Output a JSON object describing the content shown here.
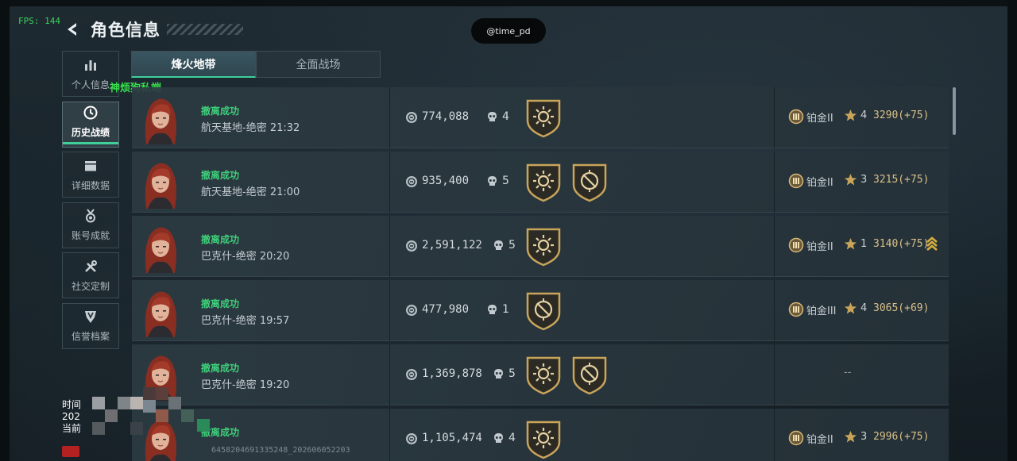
{
  "overlay": {
    "fps": "FPS: 144",
    "watermark": "@time_pd",
    "green_tag": "神烦狗私端",
    "bottom_time_lines": [
      "时间",
      "202",
      "当前"
    ],
    "bottom_id": "6458204691335248_202606052203"
  },
  "header": {
    "title": "角色信息"
  },
  "sidebar": {
    "items": [
      {
        "label": "个人信息",
        "icon": "bar-chart-icon",
        "active": false
      },
      {
        "label": "历史战绩",
        "icon": "clock-icon",
        "active": true
      },
      {
        "label": "详细数据",
        "icon": "folder-icon",
        "active": false
      },
      {
        "label": "账号成就",
        "icon": "medal-icon",
        "active": false
      },
      {
        "label": "社交定制",
        "icon": "wrench-icon",
        "active": false
      },
      {
        "label": "信誉档案",
        "icon": "shield-icon",
        "active": false
      }
    ]
  },
  "tabs": [
    {
      "label": "烽火地带",
      "active": true
    },
    {
      "label": "全面战场",
      "active": false
    }
  ],
  "matches": [
    {
      "status": "撤离成功",
      "map": "航天基地-绝密 21:32",
      "value": "774,088",
      "kills": "4",
      "badges": [
        "sun"
      ],
      "rank": "铂金II",
      "stars": "4",
      "score": "3290(+75)",
      "promo": false
    },
    {
      "status": "撤离成功",
      "map": "航天基地-绝密 21:00",
      "value": "935,400",
      "kills": "5",
      "badges": [
        "sun",
        "crosshair"
      ],
      "rank": "铂金II",
      "stars": "3",
      "score": "3215(+75)",
      "promo": false
    },
    {
      "status": "撤离成功",
      "map": "巴克什-绝密 20:20",
      "value": "2,591,122",
      "kills": "5",
      "badges": [
        "sun"
      ],
      "rank": "铂金II",
      "stars": "1",
      "score": "3140(+75)",
      "promo": true
    },
    {
      "status": "撤离成功",
      "map": "巴克什-绝密 19:57",
      "value": "477,980",
      "kills": "1",
      "badges": [
        "crosshair"
      ],
      "rank": "铂金III",
      "stars": "4",
      "score": "3065(+69)",
      "promo": false
    },
    {
      "status": "撤离成功",
      "map": "巴克什-绝密 19:20",
      "value": "1,369,878",
      "kills": "5",
      "badges": [
        "sun",
        "crosshair"
      ],
      "rank": "",
      "stars": "",
      "score": "",
      "promo": false,
      "empty_rank_text": "--"
    },
    {
      "status": "撤离成功",
      "map": "",
      "value": "1,105,474",
      "kills": "4",
      "badges": [
        "sun"
      ],
      "rank": "铂金II",
      "stars": "3",
      "score": "2996(+75)",
      "promo": false
    }
  ],
  "colors": {
    "accent_green": "#3ecf9a",
    "status_green": "#3ecf7a",
    "gold": "#c9a55a",
    "score_gold": "#d9c088"
  }
}
